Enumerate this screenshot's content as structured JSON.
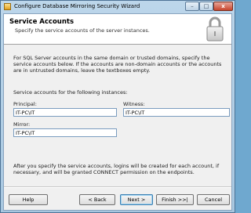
{
  "window": {
    "title": "Configure Database Mirroring Security Wizard",
    "minimize_glyph": "–",
    "maximize_glyph": "□",
    "close_glyph": "x",
    "title_icon": "wizard-app-icon"
  },
  "header": {
    "title": "Service Accounts",
    "subtitle": "Specify the service accounts of the server instances.",
    "icon": "padlock-icon"
  },
  "intro": "For SQL Server accounts in the same domain or trusted domains, specify the service accounts below. If the accounts are non-domain accounts or the accounts are in untrusted domains, leave the textboxes empty.",
  "instances_label": "Service accounts for the following instances:",
  "fields": {
    "principal": {
      "label": "Principal:",
      "value": "IT-PC\\IT"
    },
    "witness": {
      "label": "Witness:",
      "value": "IT-PC\\IT"
    },
    "mirror": {
      "label": "Mirror:",
      "value": "IT-PC\\IT"
    }
  },
  "footer_note": "After you specify the service accounts, logins will be created for each account, if necessary, and will be granted CONNECT permission on the endpoints.",
  "buttons": {
    "help": "Help",
    "back": "< Back",
    "next": "Next >",
    "finish": "Finish >>|",
    "cancel": "Cancel"
  }
}
